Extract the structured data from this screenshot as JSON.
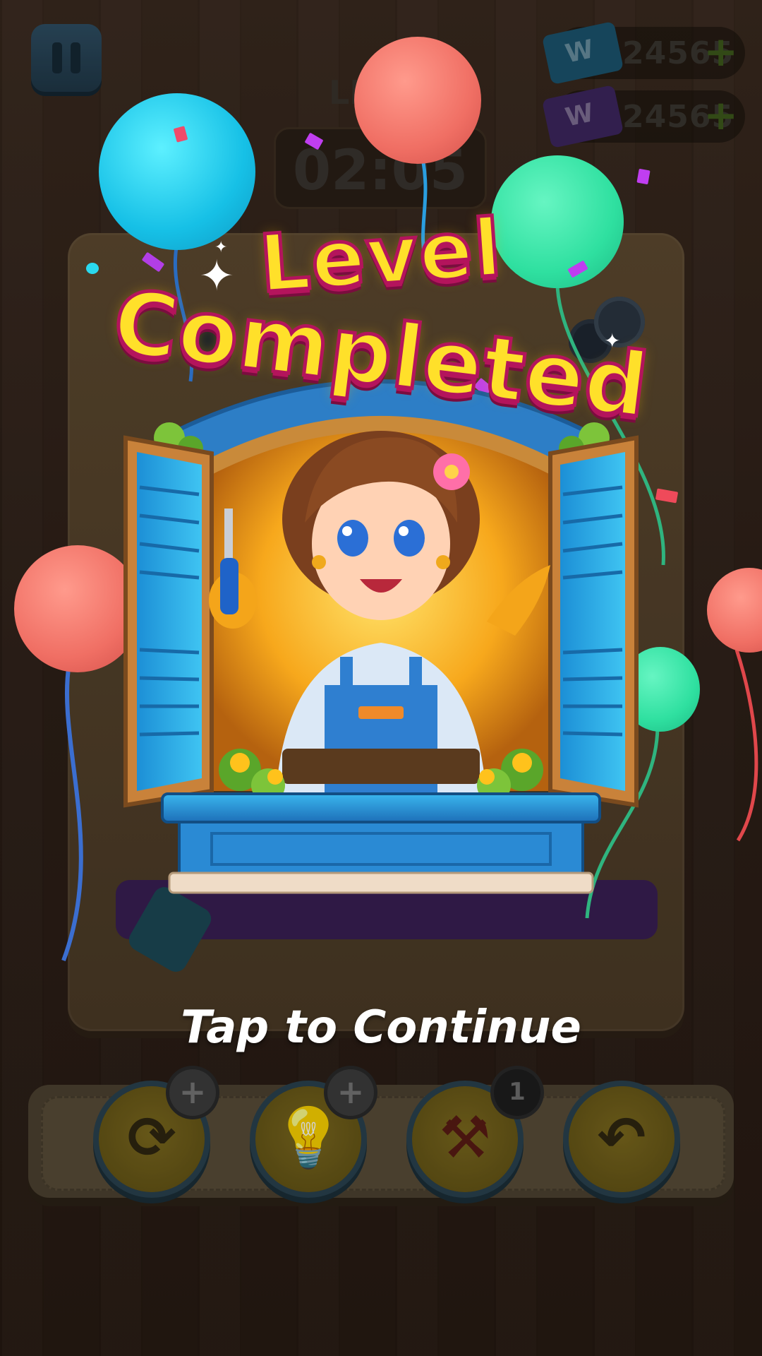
{
  "hud": {
    "pause_icon": "pause-icon",
    "currencies": [
      {
        "icon": "blue-ticket-icon",
        "ticket_letter": "W",
        "amount": "24565",
        "color": "#1b5570"
      },
      {
        "icon": "purple-ticket-icon",
        "ticket_letter": "W",
        "amount": "24565",
        "color": "#3d2660"
      }
    ],
    "add_icon": "plus-icon",
    "level_label": "LE",
    "timer": "02:05"
  },
  "overlay": {
    "title_line1": "Level",
    "title_line2": "Completed",
    "tap_to_continue": "Tap to Continue",
    "title_color": "#ffe02a",
    "title_outline_color": "#b4145c"
  },
  "toolbar": {
    "tools": [
      {
        "name": "shuffle",
        "icon": "refresh-icon",
        "badge": "+"
      },
      {
        "name": "hint",
        "icon": "lightbulb-icon",
        "badge": "+"
      },
      {
        "name": "hammer",
        "icon": "hammer-icon",
        "badge": "1"
      },
      {
        "name": "undo",
        "icon": "undo-icon",
        "badge": ""
      }
    ]
  },
  "balloon_colors": [
    "#1fd3ef",
    "#f06f64",
    "#2fe0a0"
  ]
}
